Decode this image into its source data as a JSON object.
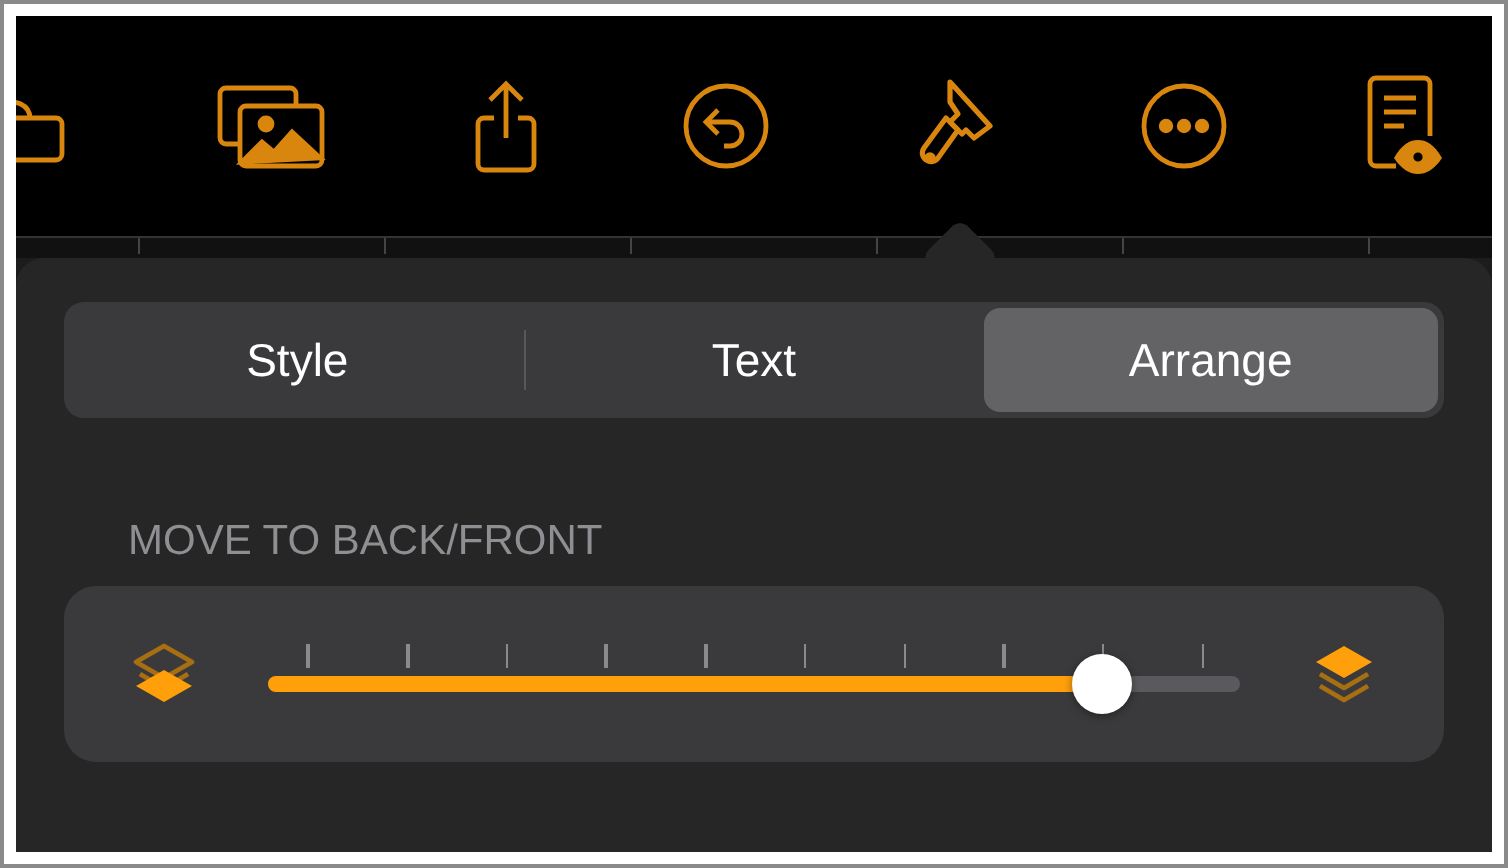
{
  "toolbar": {
    "buttons": [
      {
        "kind": "folder"
      },
      {
        "kind": "photos"
      },
      {
        "kind": "share"
      },
      {
        "kind": "undo"
      },
      {
        "kind": "brush"
      },
      {
        "kind": "more"
      },
      {
        "kind": "preview"
      }
    ]
  },
  "tabs": [
    {
      "label": "Style",
      "selected": false
    },
    {
      "label": "Text",
      "selected": false
    },
    {
      "label": "Arrange",
      "selected": true
    }
  ],
  "section_label": "MOVE TO BACK/FRONT",
  "slider": {
    "level": 0.89
  }
}
